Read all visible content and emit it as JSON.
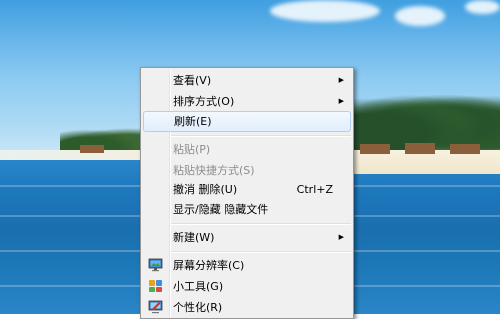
{
  "context_menu": {
    "items": [
      {
        "label": "查看(V)",
        "has_submenu": true,
        "state": "normal"
      },
      {
        "label": "排序方式(O)",
        "has_submenu": true,
        "state": "normal"
      },
      {
        "label": "刷新(E)",
        "state": "highlighted"
      },
      {
        "label": "粘贴(P)",
        "state": "disabled"
      },
      {
        "label": "粘贴快捷方式(S)",
        "state": "disabled"
      },
      {
        "label": "撤消 删除(U)",
        "shortcut": "Ctrl+Z",
        "state": "normal"
      },
      {
        "label": "显示/隐藏 隐藏文件",
        "state": "normal"
      },
      {
        "label": "新建(W)",
        "has_submenu": true,
        "state": "normal"
      },
      {
        "label": "屏幕分辨率(C)",
        "icon": "monitor-icon",
        "state": "normal"
      },
      {
        "label": "小工具(G)",
        "icon": "gadgets-icon",
        "state": "normal"
      },
      {
        "label": "个性化(R)",
        "icon": "personalize-icon",
        "state": "normal"
      }
    ],
    "submenu_arrow": "▶"
  },
  "colors": {
    "menu_bg": "#f0f0f0",
    "menu_border": "#979797",
    "highlight_border": "#aecff7",
    "disabled_text": "#8d8d8d"
  }
}
